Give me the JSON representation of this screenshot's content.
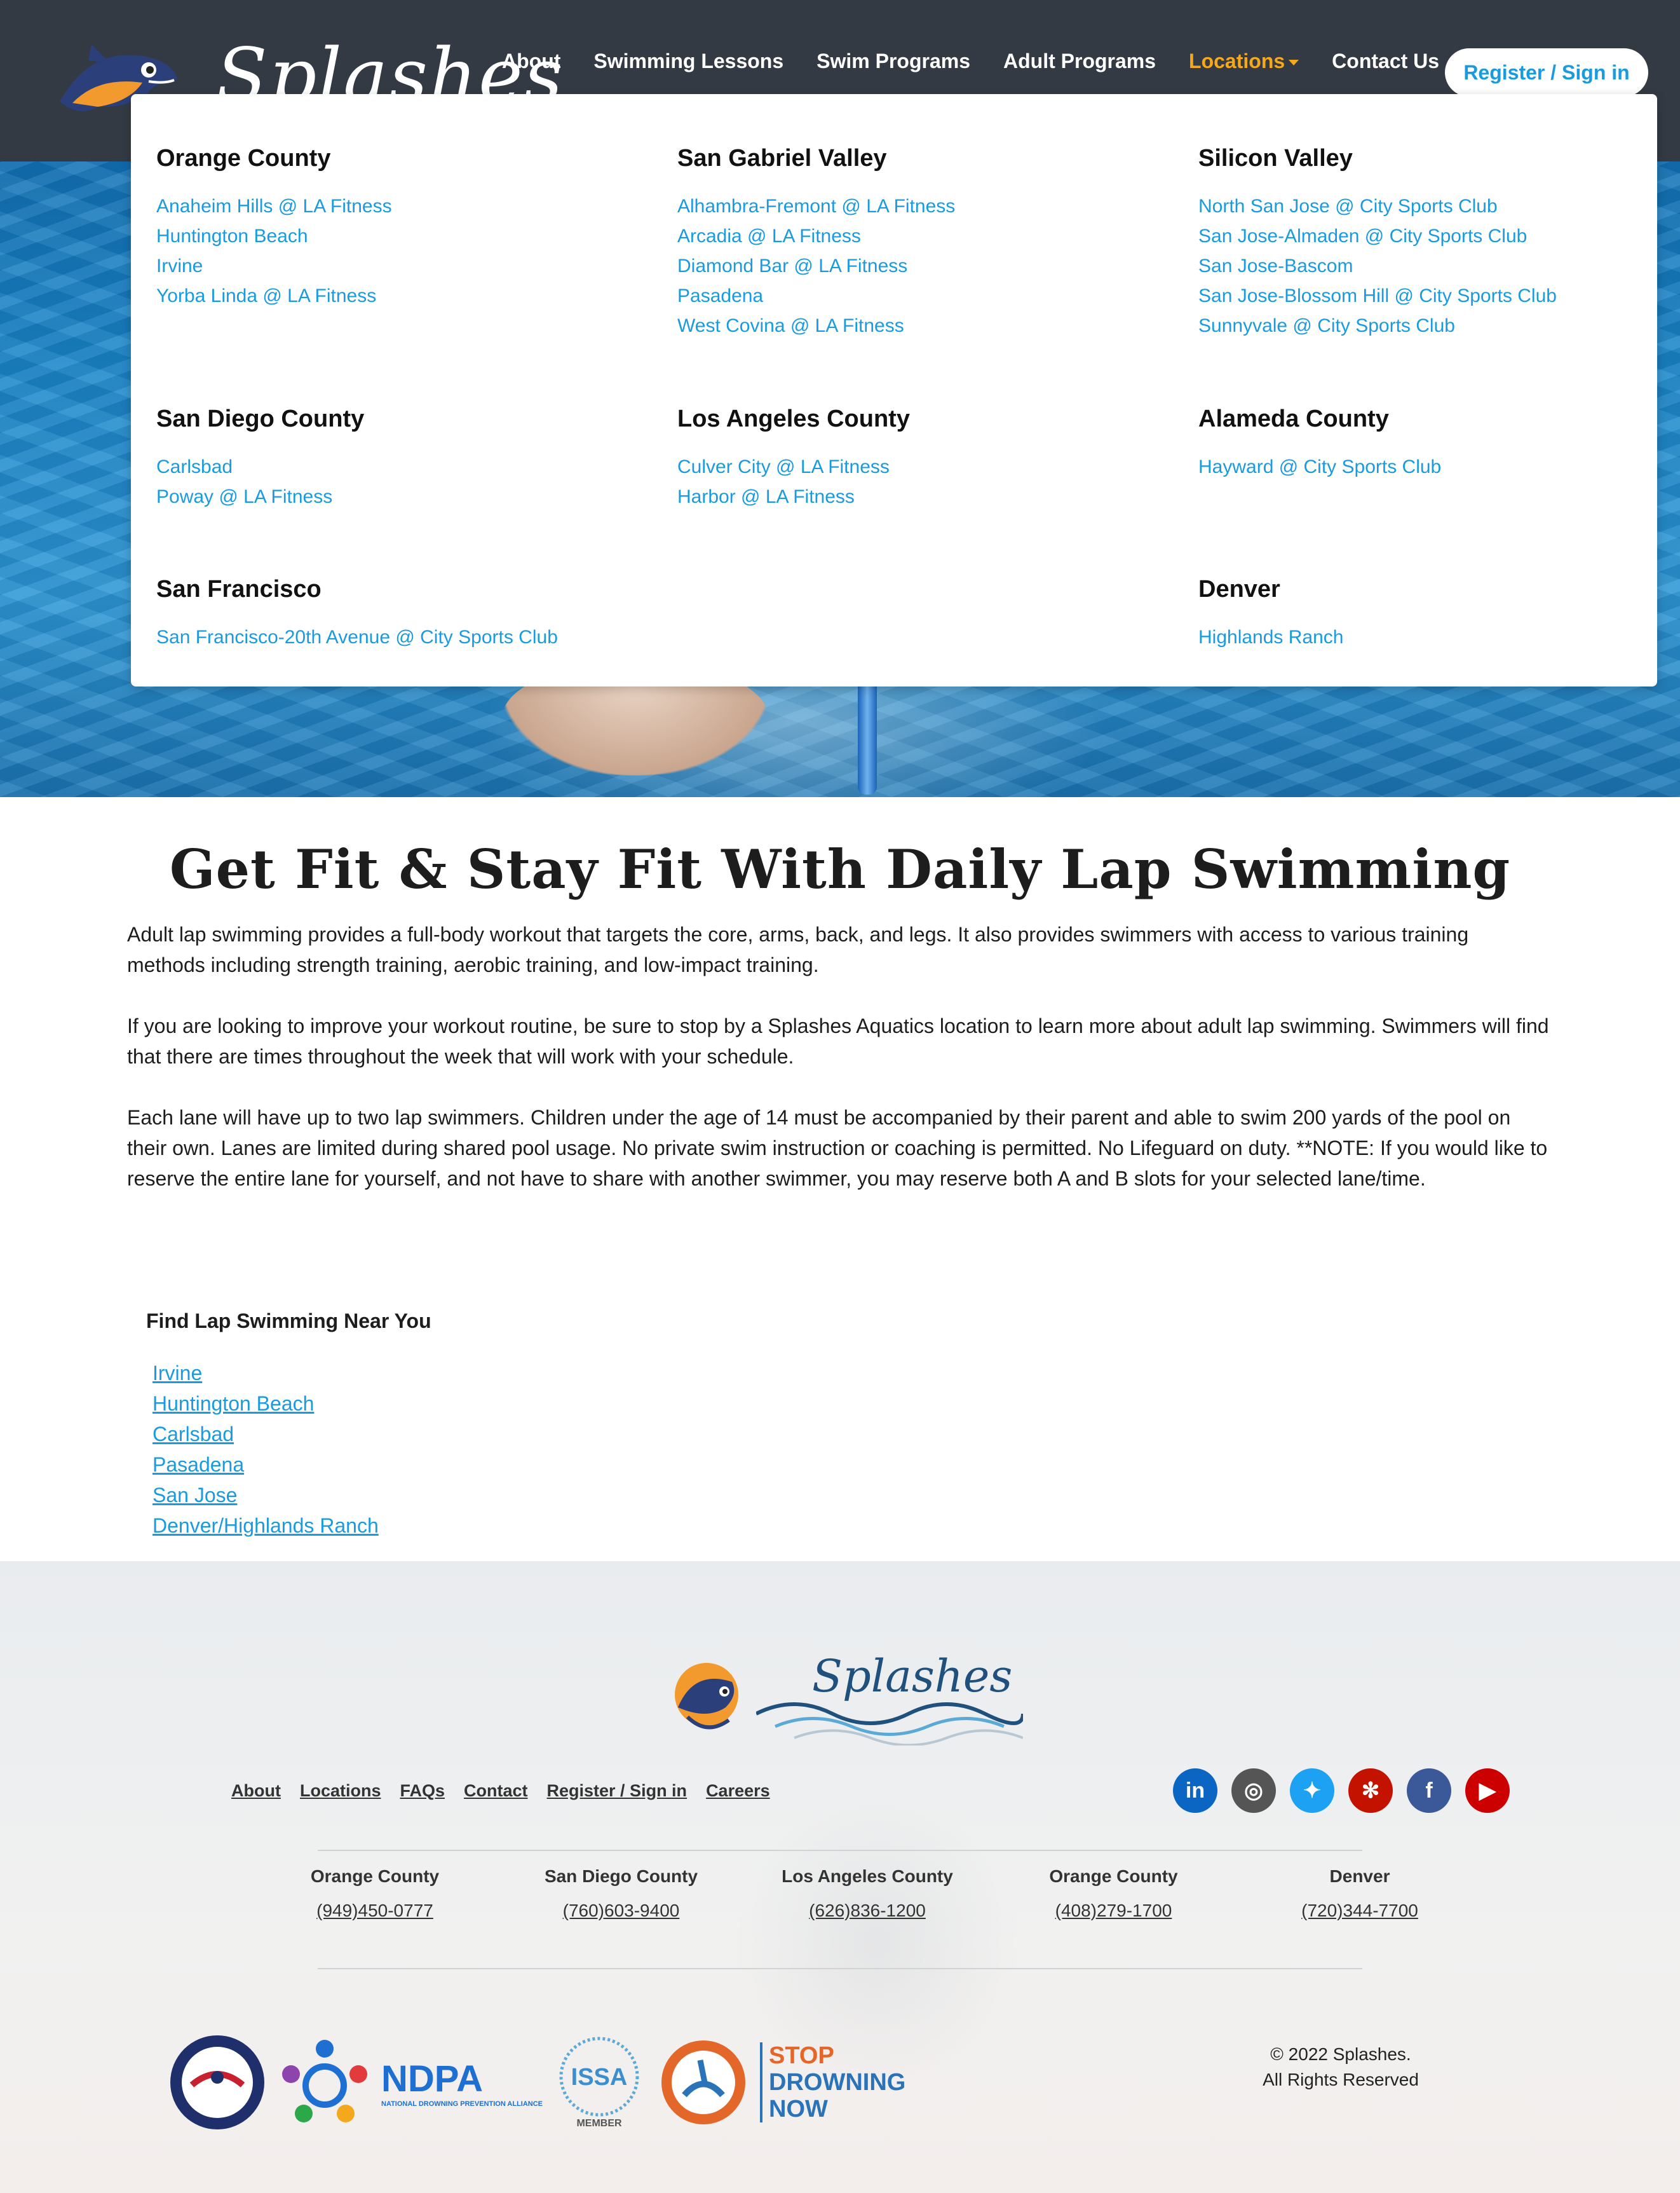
{
  "brand": {
    "name": "Splashes",
    "accent": "#1a9be0",
    "nav_active": "#f4a81c",
    "navbar_bg": "#343a43"
  },
  "nav": {
    "links": [
      "About",
      "Swimming Lessons",
      "Swim Programs",
      "Adult Programs",
      "Locations",
      "Contact Us"
    ],
    "register_label": "Register / Sign in"
  },
  "locations_menu": {
    "regions": [
      {
        "title": "Orange County",
        "links": [
          "Anaheim Hills @ LA Fitness",
          "Huntington Beach",
          "Irvine",
          "Yorba Linda @ LA Fitness"
        ]
      },
      {
        "title": "San Gabriel Valley",
        "links": [
          "Alhambra-Fremont @ LA Fitness",
          "Arcadia @ LA Fitness",
          "Diamond Bar @ LA Fitness",
          "Pasadena",
          "West Covina @ LA Fitness"
        ]
      },
      {
        "title": "Silicon Valley",
        "links": [
          "North San Jose @ City Sports Club",
          "San Jose-Almaden @ City Sports Club",
          "San Jose-Bascom",
          "San Jose-Blossom Hill @ City Sports Club",
          "Sunnyvale @ City Sports Club"
        ]
      },
      {
        "title": "San Diego County",
        "links": [
          "Carlsbad",
          "Poway @ LA Fitness"
        ]
      },
      {
        "title": "Los Angeles County",
        "links": [
          "Culver City @ LA Fitness",
          "Harbor @ LA Fitness"
        ]
      },
      {
        "title": "Alameda County",
        "links": [
          "Hayward @ City Sports Club"
        ]
      },
      {
        "title": "San Francisco",
        "links": [
          "San Francisco-20th Avenue @ City Sports Club"
        ]
      },
      {
        "title": "Denver",
        "links": [
          "Highlands Ranch"
        ]
      }
    ]
  },
  "main": {
    "title": "Get Fit & Stay Fit With Daily Lap Swimming",
    "paragraphs": [
      "Adult lap swimming provides a full-body workout that targets the core, arms, back, and legs. It also provides swimmers with access to various training methods including strength training, aerobic training, and low-impact training.",
      "If you are looking to improve your workout routine, be sure to stop by a Splashes Aquatics location to learn more about adult lap swimming. Swimmers will find that there are times throughout the week that will work with your schedule.",
      "Each lane will have up to two lap swimmers. Children under the age of 14 must be accompanied by their parent and able to swim 200 yards of the pool on their own. Lanes are limited during shared pool usage. No private swim instruction or coaching is permitted. No Lifeguard on duty. **NOTE: If you would like to reserve the entire lane for yourself, and not have to share with another swimmer, you may reserve both A and B slots for your selected lane/time."
    ],
    "find_title": "Find Lap Swimming Near You",
    "find_links": [
      "Irvine",
      "Huntington Beach",
      "Carlsbad",
      "Pasadena",
      "San Jose",
      "Denver/Highlands Ranch"
    ]
  },
  "footer": {
    "logo_text": "Splashes",
    "links": [
      "About",
      "Locations",
      "FAQs",
      "Contact",
      "Register / Sign in",
      "Careers"
    ],
    "social": [
      {
        "icon": "linkedin-icon",
        "glyph": "in",
        "color": "#0a66c2"
      },
      {
        "icon": "instagram-icon",
        "glyph": "◎",
        "color": "#555555"
      },
      {
        "icon": "twitter-icon",
        "glyph": "✦",
        "color": "#1da1f2"
      },
      {
        "icon": "yelp-icon",
        "glyph": "✻",
        "color": "#c41200"
      },
      {
        "icon": "facebook-icon",
        "glyph": "f",
        "color": "#3b5998"
      },
      {
        "icon": "youtube-icon",
        "glyph": "▶",
        "color": "#cc0000"
      }
    ],
    "contacts": [
      {
        "region": "Orange County",
        "phone": "(949)450-0777"
      },
      {
        "region": "San Diego County",
        "phone": "(760)603-9400"
      },
      {
        "region": "Los Angeles County",
        "phone": "(626)836-1200"
      },
      {
        "region": "Orange County",
        "phone": "(408)279-1700"
      },
      {
        "region": "Denver",
        "phone": "(720)344-7700"
      }
    ],
    "badges": {
      "ndpa_title": "NDPA",
      "ndpa_sub": "NATIONAL DROWNING PREVENTION ALLIANCE",
      "issa_title": "ISSA",
      "issa_sub": "MEMBER",
      "stop_drowning": [
        "STOP",
        "DROWNING",
        "NOW"
      ]
    },
    "copyright_line1": "© 2022 Splashes.",
    "copyright_line2": "All Rights Reserved"
  }
}
